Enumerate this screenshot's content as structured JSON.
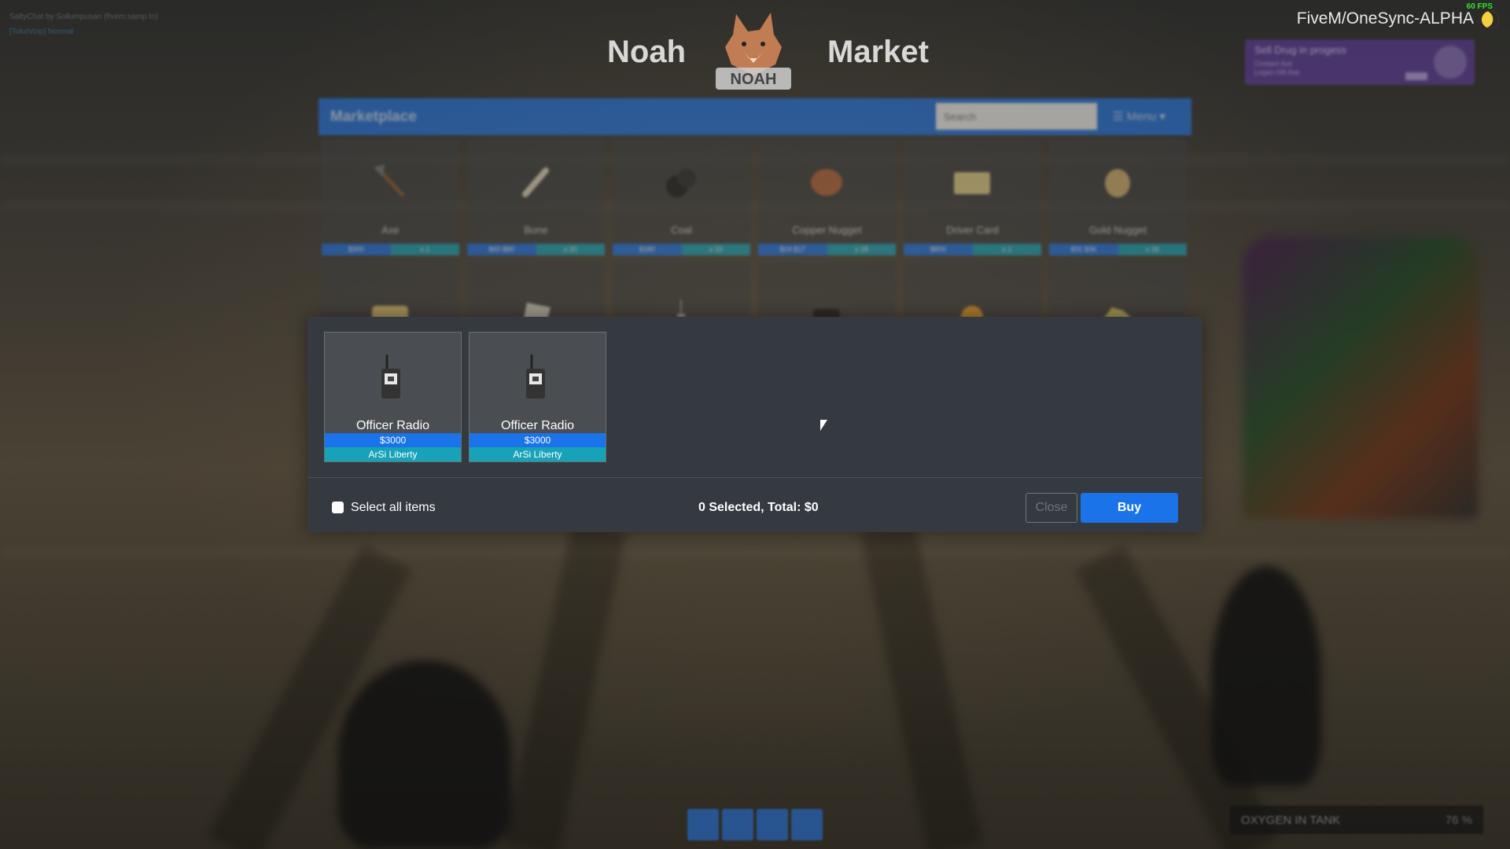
{
  "hud": {
    "voip_line1": "SaltyChat by Sollumpusan (fivem.samp.to)",
    "voip_line2": "[TokoVoip] Normal",
    "fps": "60 FPS",
    "server": "FiveM/OneSync-ALPHA",
    "notification": {
      "title": "Sell Drug in progess",
      "sub1": "Contact Ave",
      "sub2": "Logan Hill Ave"
    },
    "oxygen_label": "OXYGEN IN TANK",
    "oxygen_value": "76 %",
    "icons": [
      "heart-icon",
      "briefcase-icon",
      "water-drop-icon",
      "speaker-icon"
    ]
  },
  "header": {
    "left": "Noah",
    "right": "Market",
    "logo_text": "NOAH"
  },
  "market": {
    "title": "Marketplace",
    "search_placeholder": "Search",
    "menu_label": "☰ Menu ▾",
    "items": [
      {
        "name": "Axe",
        "price": "$300",
        "qty": "x 1",
        "icon": "axe-icon"
      },
      {
        "name": "Bone",
        "price": "$60 $80",
        "qty": "x 20",
        "icon": "bone-icon"
      },
      {
        "name": "Coal",
        "price": "$180",
        "qty": "x 10",
        "icon": "coal-icon"
      },
      {
        "name": "Copper Nugget",
        "price": "$14 $17",
        "qty": "x 18",
        "icon": "copper-nugget-icon"
      },
      {
        "name": "Driver Card",
        "price": "$800",
        "qty": "x 1",
        "icon": "driver-card-icon"
      },
      {
        "name": "Gold Nugget",
        "price": "$31 $36",
        "qty": "x 16",
        "icon": "gold-nugget-icon"
      }
    ],
    "row2_icons": [
      "gold-bar-icon",
      "paper-bag-icon",
      "radio-icon",
      "camera-icon",
      "orange-icon",
      "gold-pile-icon"
    ]
  },
  "modal": {
    "items": [
      {
        "name": "Officer Radio",
        "price": "$3000",
        "seller": "ArSi Liberty",
        "icon": "radio-icon"
      },
      {
        "name": "Officer Radio",
        "price": "$3000",
        "seller": "ArSi Liberty",
        "icon": "radio-icon"
      }
    ],
    "select_all_label": "Select all items",
    "summary": "0 Selected, Total: $0",
    "close_label": "Close",
    "buy_label": "Buy"
  },
  "colors": {
    "primary": "#1a73e8",
    "info": "#17a2b8",
    "modal_bg": "#343a40",
    "fps": "#2fe62f"
  }
}
